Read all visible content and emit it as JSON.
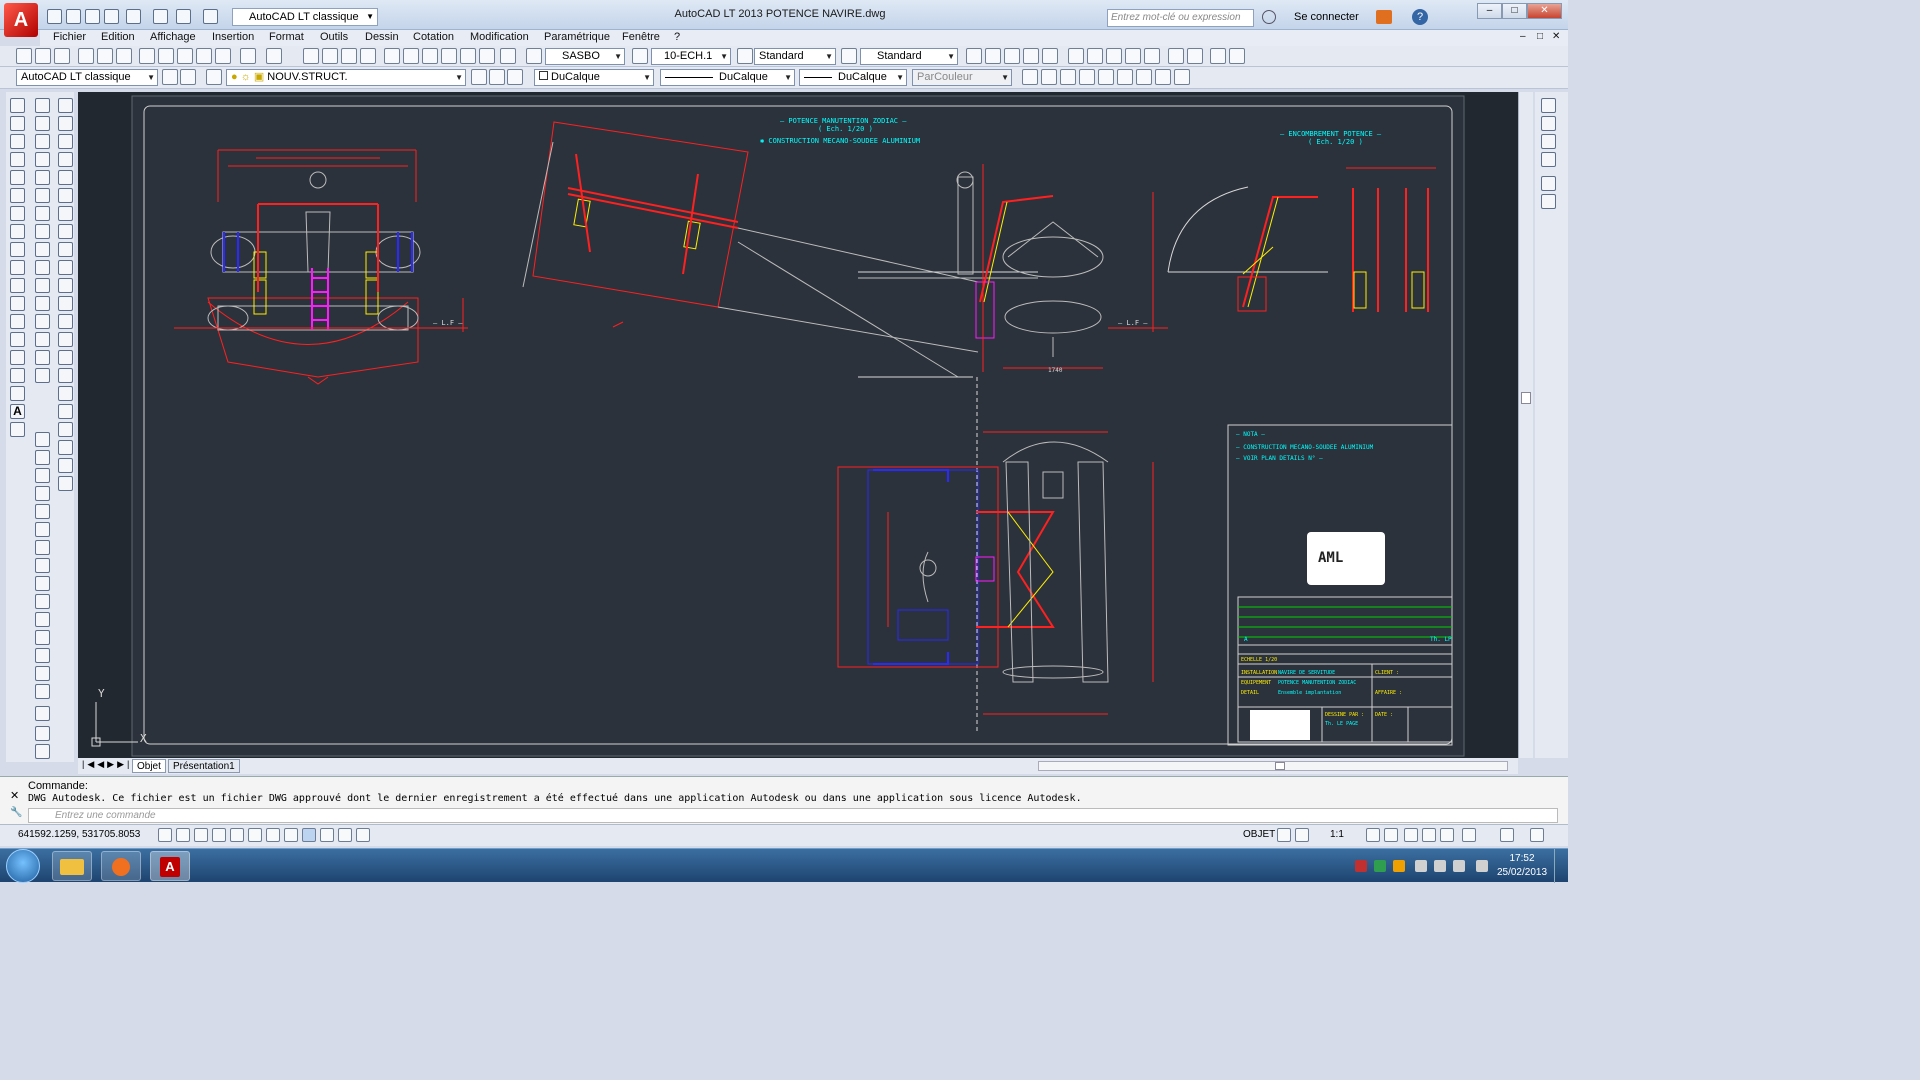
{
  "window": {
    "title": "AutoCAD LT 2013     POTENCE NAVIRE.dwg",
    "workspace": "AutoCAD LT classique",
    "search_placeholder": "Entrez mot-clé ou expression",
    "signin": "Se connecter",
    "logo": "A"
  },
  "menu": [
    "Fichier",
    "Edition",
    "Affichage",
    "Insertion",
    "Format",
    "Outils",
    "Dessin",
    "Cotation",
    "Modification",
    "Paramétrique",
    "Fenêtre",
    "?"
  ],
  "toolbar1": {
    "text_style": "SASBO",
    "dim_style": "10-ECH.1",
    "table_style": "Standard",
    "multileader_style": "Standard"
  },
  "toolbar2": {
    "workspace": "AutoCAD LT classique",
    "layer": "NOUV.STRUCT.",
    "color": "DuCalque",
    "linetype": "DuCalque",
    "lineweight": "DuCalque",
    "plotstyle": "ParCouleur"
  },
  "drawing": {
    "title1": "– POTENCE MANUTENTION ZODIAC –",
    "title1_scale": "( Ech. 1/20 )",
    "title1_note": "✱ CONSTRUCTION MECANO-SOUDEE ALUMINIUM",
    "title2": "– ENCOMBREMENT POTENCE –",
    "title2_scale": "( Ech. 1/20 )",
    "notes_title": "– NOTA –",
    "note1": "– CONSTRUCTION MECANO-SOUDEE ALUMINIUM",
    "note2": "– VOIR PLAN DETAILS N° –",
    "waterline": "– L.F –",
    "dim_1740": "1740",
    "tb_installation": "INSTALLATION",
    "tb_installation_val": "NAVIRE DE SERVITUDE",
    "tb_equipement": "EQUIPEMENT",
    "tb_equipement_val": "POTENCE MANUTENTION ZODIAC",
    "tb_detail": "DETAIL",
    "tb_detail_val": "Ensemble implantation",
    "tb_echelle": "ECHELLE 1/20",
    "tb_client": "CLIENT :",
    "tb_affaire": "AFFAIRE :",
    "tb_dessine": "DESSINE PAR :",
    "tb_dessinateur": "Th. LE PAGE",
    "tb_date": "DATE :",
    "tb_rev": "A",
    "tb_rev_author": "Th. LP",
    "tb_logo": "AML"
  },
  "tabs": [
    "Objet",
    "Présentation1"
  ],
  "command": {
    "label": "Commande:",
    "message": "DWG Autodesk.  Ce fichier est un fichier DWG approuvé dont le dernier enregistrement a été effectué dans une application Autodesk ou dans une application sous licence Autodesk.",
    "placeholder": "Entrez une commande"
  },
  "status": {
    "coords": "641592.1259, 531705.8053",
    "space": "OBJET",
    "scale": "1:1"
  },
  "clock": {
    "time": "17:52",
    "date": "25/02/2013"
  },
  "ucs": {
    "x": "X",
    "y": "Y"
  },
  "colors": {
    "canvas": "#212830",
    "red": "#ff2020",
    "yellow": "#ffee00",
    "cyan": "#00ffff",
    "magenta": "#ff1aff",
    "blue": "#2a2aff",
    "white": "#d8d8d8"
  }
}
